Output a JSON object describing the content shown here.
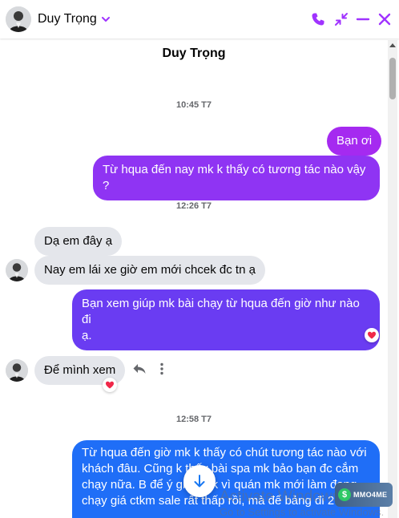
{
  "header": {
    "name": "Duy Trọng",
    "icons": [
      "phone-icon",
      "minimize-arrows-icon",
      "minus-icon",
      "close-icon"
    ],
    "accent": "#a033ff"
  },
  "conversation": {
    "title": "Duy Trọng",
    "timestamps": [
      "10:45 T7",
      "12:26 T7",
      "12:58 T7"
    ],
    "messages": [
      {
        "from": "me",
        "text": "Bạn ơi"
      },
      {
        "from": "me",
        "text": "Từ hqua đến nay mk k thấy có tương tác nào vậy ?"
      },
      {
        "from": "them",
        "text": "Dạ em đây ạ"
      },
      {
        "from": "them",
        "text": "Nay em lái xe giờ em mới chcek đc tn ạ"
      },
      {
        "from": "me",
        "text_line1": "Bạn xem giúp mk bài chạy từ hqua đến giờ như nào đi",
        "text_line2": "ạ.",
        "reaction": "heart"
      },
      {
        "from": "them",
        "text": "Để mình xem",
        "reaction": "heart"
      },
      {
        "from": "me",
        "lines": [
          "Từ hqua đến giờ mk k thấy có chút tương tác nào với",
          "khách đâu. Cũng k thấy bài spa mk bảo bạn đc cắm",
          "chạy nữa. B để ý giúp mk vì quán mk mới làm đang",
          "chạy giá ctkm sale rất thấp rồi, mà để bảng đi 2 ngày"
        ]
      }
    ],
    "colors": {
      "bubble_purple": "#9b2ef3",
      "bubble_indigo": "#6a3cf2",
      "bubble_blue": "#1f6ef7",
      "incoming": "#e4e6eb"
    }
  },
  "watermark": {
    "line1": "Activate Windows",
    "line2": "Go to Settings to activate Windows."
  },
  "badge": {
    "text": "MMO4ME",
    "coin": "$"
  }
}
